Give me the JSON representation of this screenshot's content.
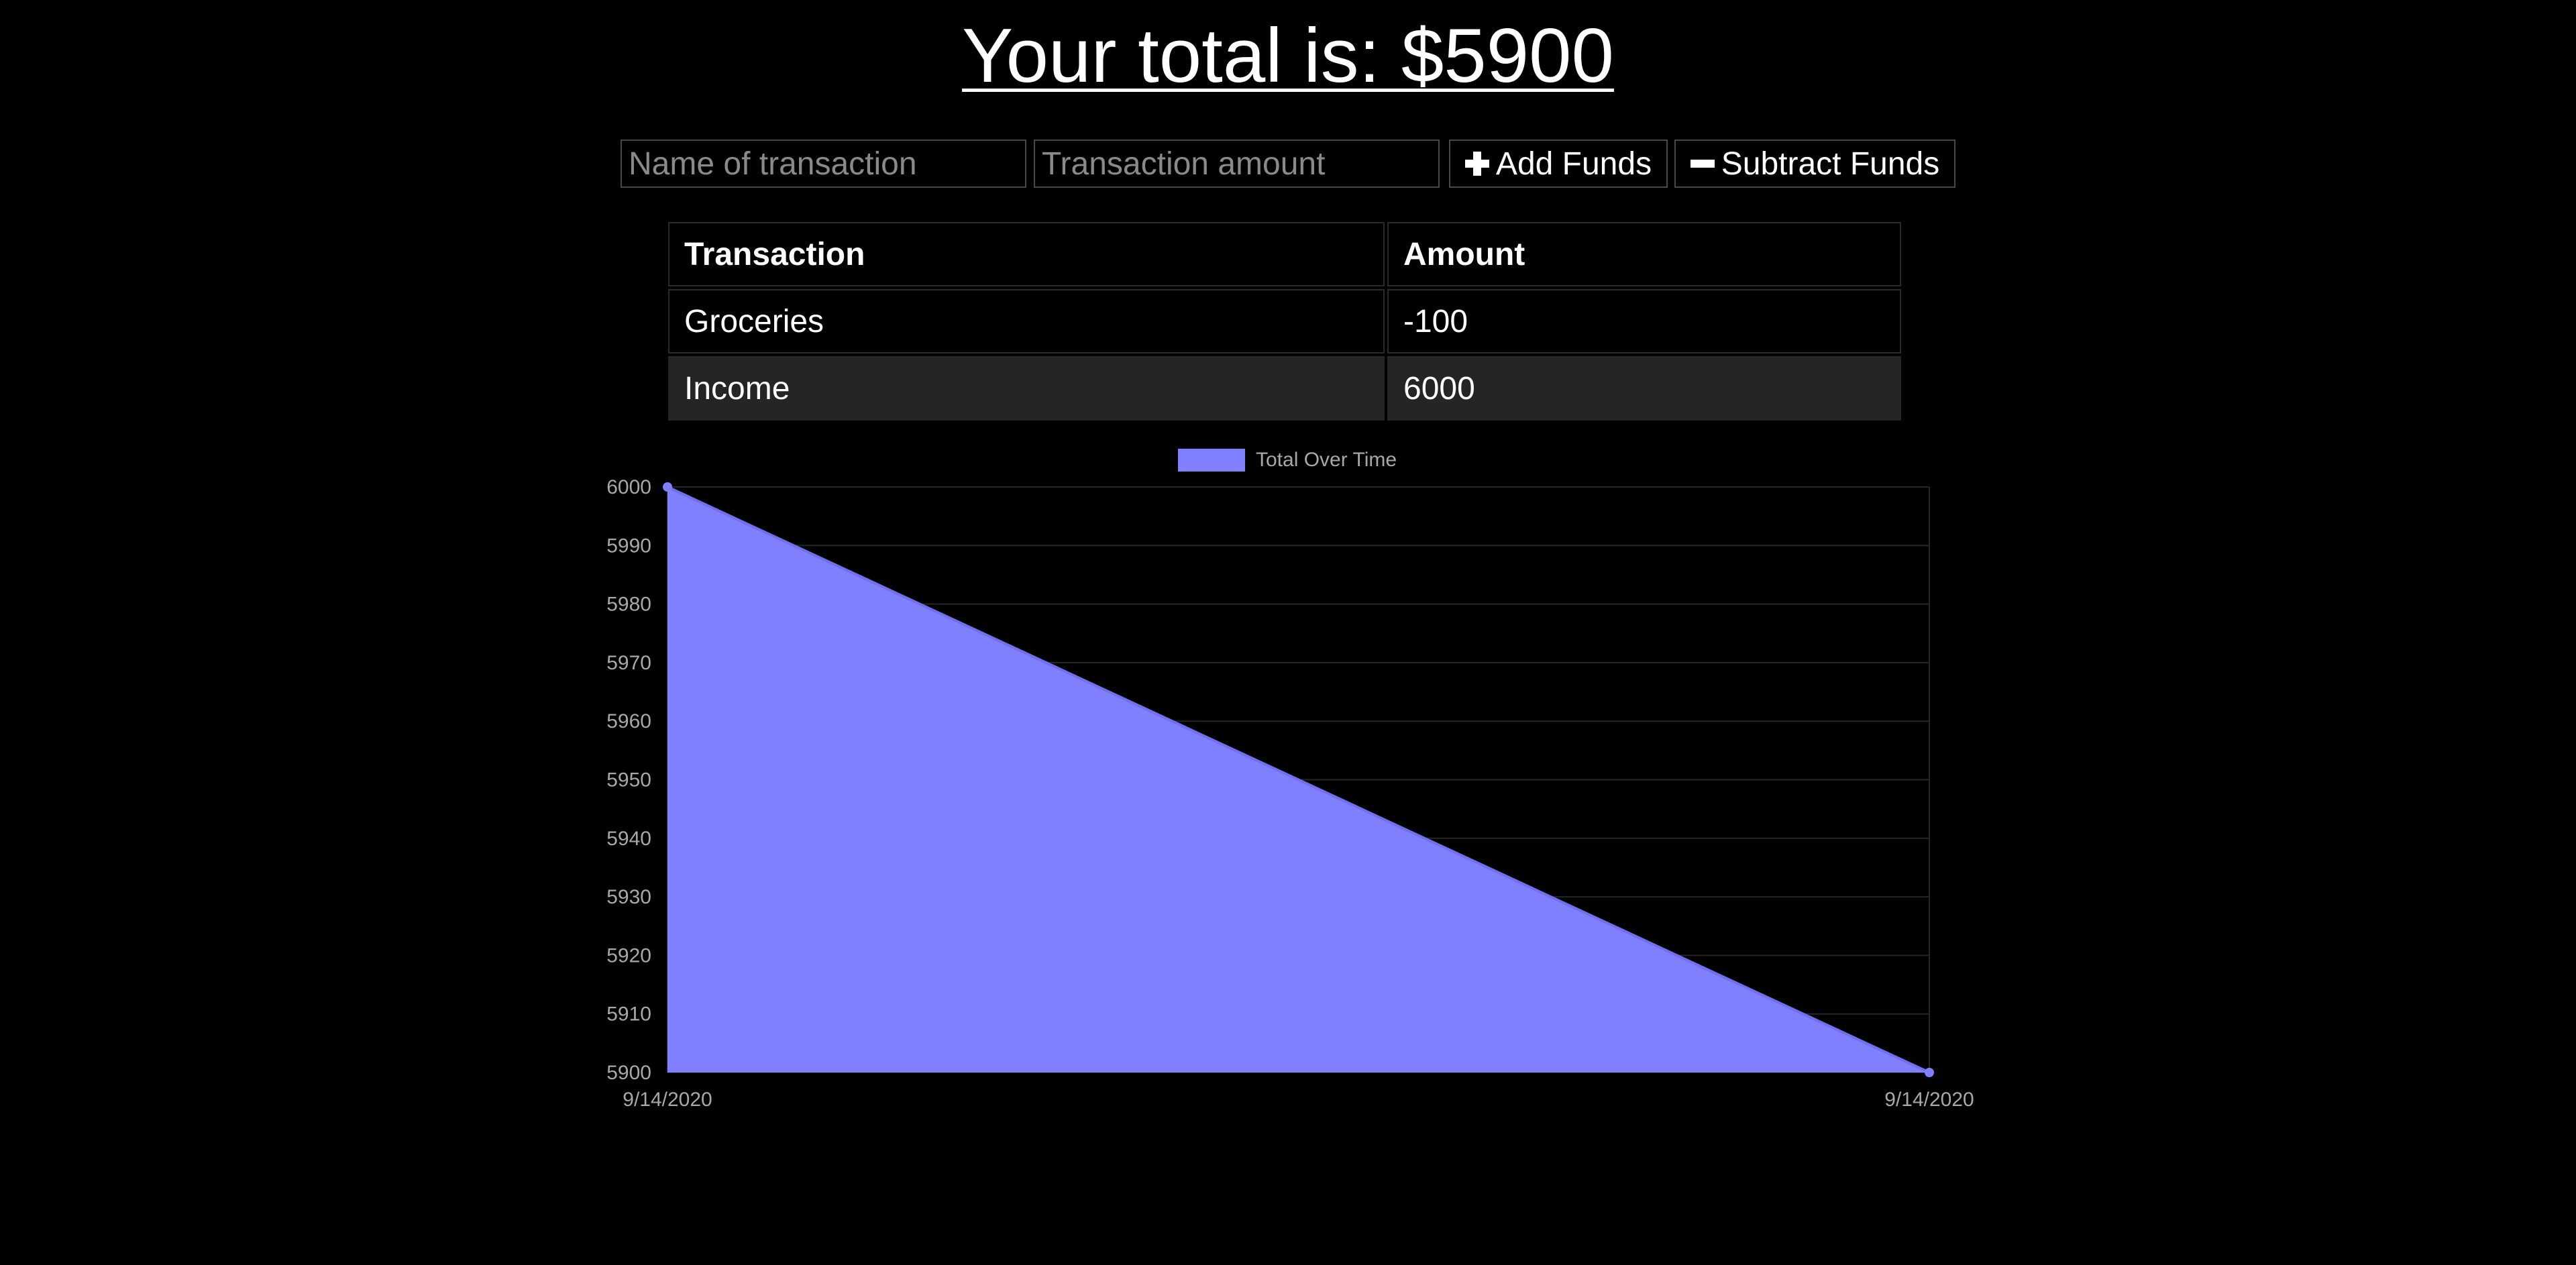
{
  "header": {
    "total_text": "Your total is: $5900"
  },
  "form": {
    "name_placeholder": "Name of transaction",
    "amount_placeholder": "Transaction amount",
    "add_label": "Add Funds",
    "subtract_label": "Subtract Funds",
    "add_icon": "plus-icon",
    "subtract_icon": "minus-icon"
  },
  "table": {
    "headers": [
      "Transaction",
      "Amount"
    ],
    "rows": [
      {
        "name": "Groceries",
        "amount": "-100"
      },
      {
        "name": "Income",
        "amount": "6000"
      }
    ]
  },
  "chart_data": {
    "type": "area",
    "legend_position": "top",
    "x": [
      "9/14/2020",
      "9/14/2020"
    ],
    "series": [
      {
        "name": "Total Over Time",
        "values": [
          6000,
          5900
        ],
        "color": "#8080ff"
      }
    ],
    "ylim": [
      5900,
      6000
    ],
    "yticks": [
      6000,
      5990,
      5980,
      5970,
      5960,
      5950,
      5940,
      5930,
      5920,
      5910,
      5900
    ],
    "grid": true
  }
}
